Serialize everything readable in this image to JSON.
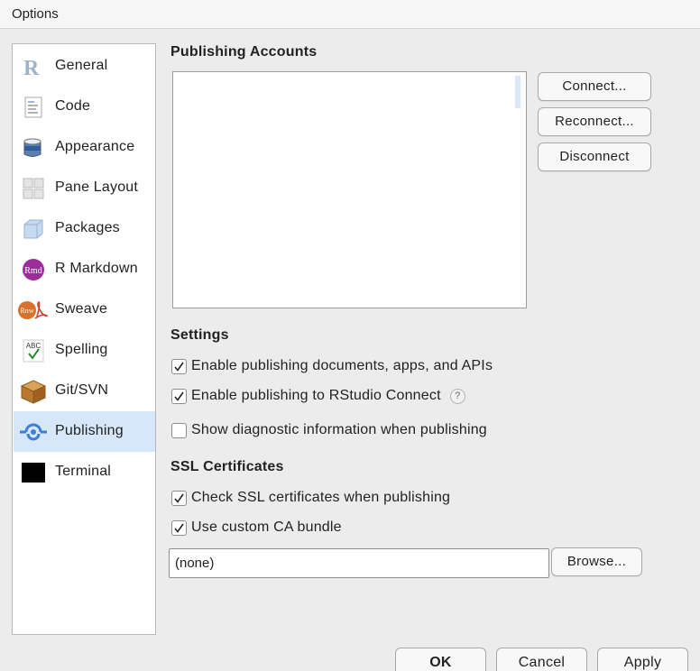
{
  "window": {
    "title": "Options"
  },
  "sidebar": {
    "items": [
      {
        "label": "General",
        "icon": "r-logo-icon"
      },
      {
        "label": "Code",
        "icon": "code-document-icon"
      },
      {
        "label": "Appearance",
        "icon": "paint-bucket-icon"
      },
      {
        "label": "Pane Layout",
        "icon": "pane-layout-icon"
      },
      {
        "label": "Packages",
        "icon": "package-box-icon"
      },
      {
        "label": "R Markdown",
        "icon": "rmd-icon"
      },
      {
        "label": "Sweave",
        "icon": "sweave-icon"
      },
      {
        "label": "Spelling",
        "icon": "spelling-abc-icon"
      },
      {
        "label": "Git/SVN",
        "icon": "git-box-icon"
      },
      {
        "label": "Publishing",
        "icon": "publishing-icon",
        "selected": true
      },
      {
        "label": "Terminal",
        "icon": "terminal-icon"
      }
    ]
  },
  "publishing_accounts": {
    "title": "Publishing Accounts",
    "connect_label": "Connect...",
    "reconnect_label": "Reconnect...",
    "disconnect_label": "Disconnect"
  },
  "settings": {
    "title": "Settings",
    "enable_publishing": {
      "label": "Enable publishing documents, apps, and APIs",
      "checked": true
    },
    "enable_rstudio_connect": {
      "label": "Enable publishing to RStudio Connect",
      "checked": true,
      "help_icon": "?"
    },
    "show_diagnostic": {
      "label": "Show diagnostic information when publishing",
      "checked": false
    }
  },
  "ssl": {
    "title": "SSL Certificates",
    "check_ssl": {
      "label": "Check SSL certificates when publishing",
      "checked": true
    },
    "custom_ca": {
      "label": "Use custom CA bundle",
      "checked": true
    },
    "ca_path_value": "(none)",
    "browse_label": "Browse..."
  },
  "footer": {
    "ok_label": "OK",
    "cancel_label": "Cancel",
    "apply_label": "Apply"
  },
  "colors": {
    "selected_bg": "#d6e7f9",
    "window_bg": "#ececec"
  }
}
